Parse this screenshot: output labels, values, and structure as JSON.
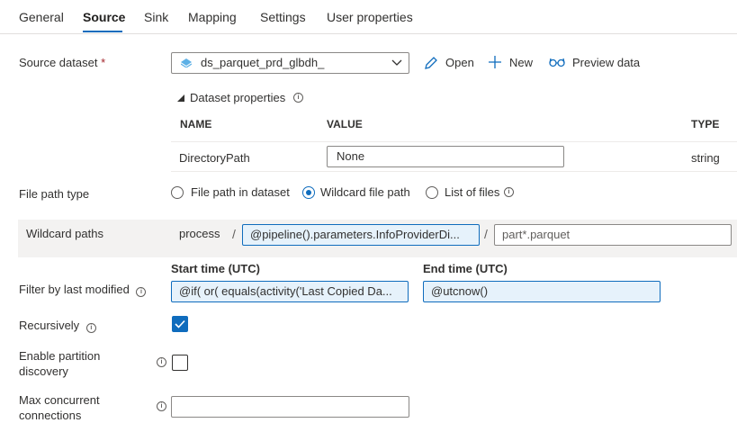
{
  "tabs": [
    {
      "label": "General"
    },
    {
      "label": "Source"
    },
    {
      "label": "Sink"
    },
    {
      "label": "Mapping"
    },
    {
      "label": "Settings"
    },
    {
      "label": "User properties"
    }
  ],
  "source_dataset": {
    "label": "Source dataset",
    "required_mark": "*",
    "value": "ds_parquet_prd_glbdh_",
    "open_label": "Open",
    "new_label": "New",
    "preview_label": "Preview data"
  },
  "dataset_properties": {
    "toggle_label": "Dataset properties",
    "headers": {
      "name": "NAME",
      "value": "VALUE",
      "type": "TYPE"
    },
    "rows": [
      {
        "name": "DirectoryPath",
        "value": "None",
        "type": "string"
      }
    ]
  },
  "file_path_type": {
    "label": "File path type",
    "options": [
      {
        "label": "File path in dataset",
        "selected": false
      },
      {
        "label": "Wildcard file path",
        "selected": true
      },
      {
        "label": "List of files",
        "selected": false
      }
    ]
  },
  "wildcard_paths": {
    "label": "Wildcard paths",
    "root": "process",
    "separator": "/",
    "folder_value": "@pipeline().parameters.InfoProviderDi...",
    "file_placeholder": "part*.parquet"
  },
  "filter_last_modified": {
    "label": "Filter by last modified",
    "start_label": "Start time (UTC)",
    "start_value": "@if( or( equals(activity('Last Copied Da...",
    "end_label": "End time (UTC)",
    "end_value": "@utcnow()"
  },
  "recursively": {
    "label": "Recursively",
    "checked": true
  },
  "partition_discovery": {
    "label_line1": "Enable partition",
    "label_line2": "discovery",
    "checked": false
  },
  "max_concurrent": {
    "label": "Max concurrent",
    "label_line2": "connections",
    "value": ""
  },
  "colors": {
    "accent": "#0f6cbd",
    "highlight_bg": "#e6f2fb"
  }
}
